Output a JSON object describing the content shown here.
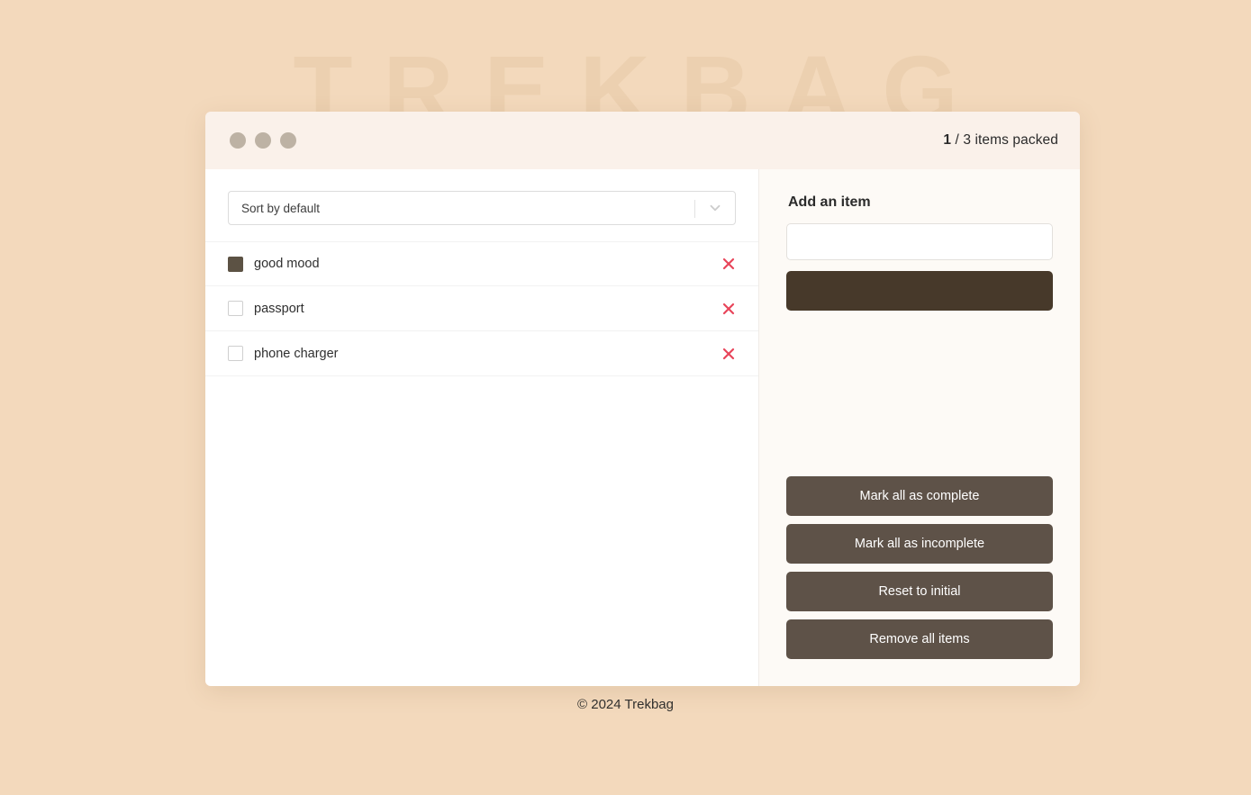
{
  "background": {
    "watermark": "TREKBAG",
    "page_color": "#f3d9bc",
    "watermark_color": "#ecd0b0"
  },
  "header": {
    "logo_dots": 3,
    "dot_color": "#bdb2a4",
    "packed_count": "1",
    "counter_suffix": "/ 3 items packed",
    "background": "#faf1ea"
  },
  "list_pane": {
    "sort": {
      "label": "Sort by default",
      "chevron_icon": "chevron-down-icon"
    },
    "items": [
      {
        "label": "good mood",
        "packed": true,
        "delete_icon": "close-icon"
      },
      {
        "label": "passport",
        "packed": false,
        "delete_icon": "close-icon"
      },
      {
        "label": "phone charger",
        "packed": false,
        "delete_icon": "close-icon"
      }
    ],
    "checked_color": "#5c5244",
    "delete_color": "#e8455a"
  },
  "sidebar": {
    "title": "Add an item",
    "input": {
      "value": "",
      "placeholder": ""
    },
    "add_button_label": "",
    "add_button_color": "#47392a",
    "actions": [
      {
        "label": "Mark all as complete"
      },
      {
        "label": "Mark all as incomplete"
      },
      {
        "label": "Reset to initial"
      },
      {
        "label": "Remove all items"
      }
    ],
    "action_button_color": "#5e5248",
    "background": "#fdfaf6"
  },
  "footer": {
    "text": "© 2024 Trekbag"
  }
}
